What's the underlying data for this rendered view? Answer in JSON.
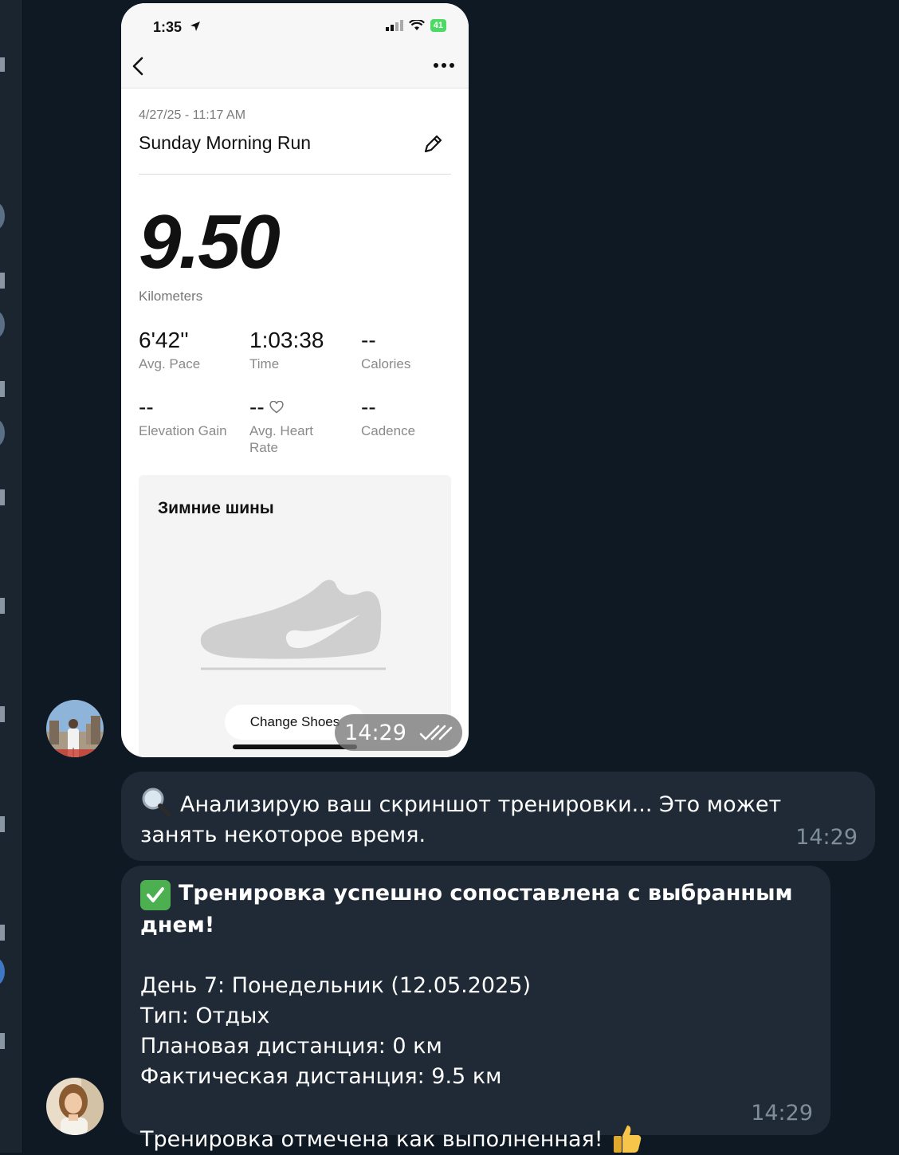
{
  "phone": {
    "status_time": "1:35",
    "battery": "41",
    "run_date": "4/27/25 - 11:17 AM",
    "run_title": "Sunday Morning Run",
    "distance_value": "9.50",
    "distance_unit": "Kilometers",
    "stats": [
      {
        "value": "6'42''",
        "label": "Avg. Pace"
      },
      {
        "value": "1:03:38",
        "label": "Time"
      },
      {
        "value": "--",
        "label": "Calories"
      },
      {
        "value": "--",
        "label": "Elevation Gain"
      },
      {
        "value": "--",
        "label": "Avg. Heart Rate"
      },
      {
        "value": "--",
        "label": "Cadence"
      }
    ],
    "shoe_name": "Зимние шины",
    "change_shoes_label": "Change Shoes",
    "image_time": "14:29"
  },
  "messages": {
    "m1": {
      "text": "Анализирую ваш скриншот тренировки... Это может занять некоторое время.",
      "time": "14:29"
    },
    "m2": {
      "heading": "Тренировка успешно сопоставлена с выбранным днем!",
      "day": "День 7: Понедельник (12.05.2025)",
      "type": "Тип: Отдых",
      "planned": "Плановая дистанция: 0 км",
      "actual": "Фактическая дистанция: 9.5 км",
      "done": "Тренировка отмечена как выполненная!",
      "time": "14:29"
    }
  },
  "colors": {
    "background": "#0f1924",
    "bubble": "#1f2a36",
    "time_text": "#7f8d9b",
    "check_green": "#4caf50"
  }
}
